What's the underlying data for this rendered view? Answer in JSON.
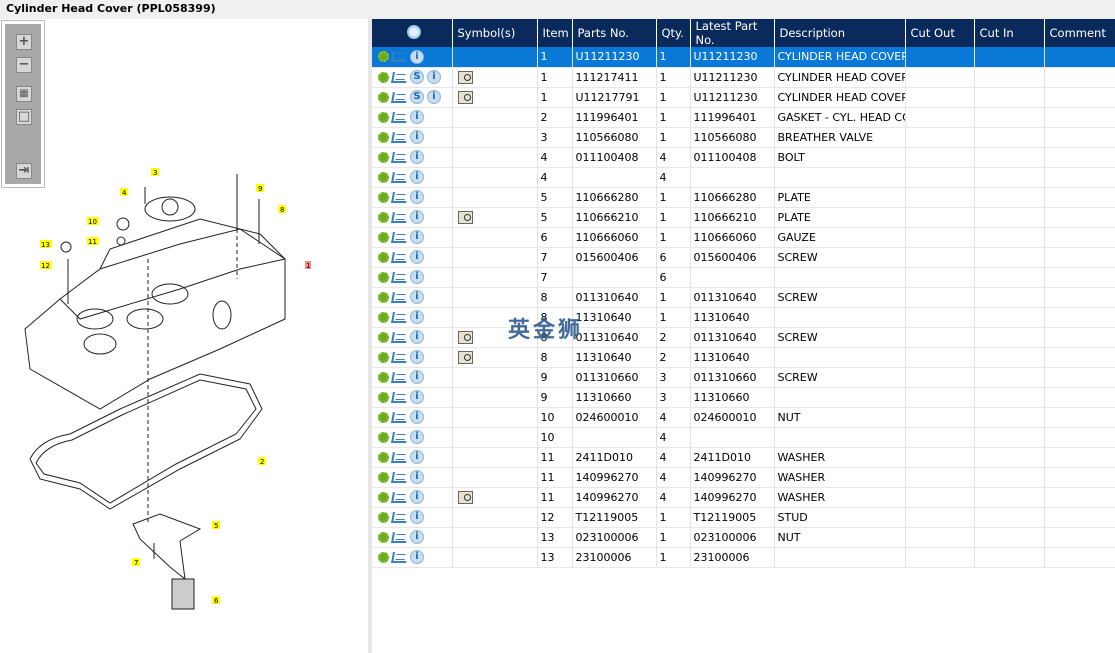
{
  "title": "Cylinder Head Cover (PPL058399)",
  "toolbar": {
    "zoom_in": "+",
    "zoom_out": "−",
    "fit": "▦",
    "actual": "□",
    "export": "⇥"
  },
  "diagram": {
    "callouts": [
      "1",
      "2",
      "3",
      "4",
      "5",
      "6",
      "7",
      "8",
      "9",
      "10",
      "11",
      "12",
      "13"
    ]
  },
  "watermark": "英金狮",
  "colors": {
    "header": "#0b2a5c",
    "selected": "#0a78d7",
    "callout": "#ffff00"
  },
  "table": {
    "headers": [
      "",
      "Symbol(s)",
      "Item",
      "Parts No.",
      "Qty.",
      "Latest Part No.",
      "Description",
      "Cut Out",
      "Cut In",
      "Comment"
    ],
    "rows": [
      {
        "s": false,
        "b": false,
        "item": "1",
        "part": "U11211230",
        "qty": "1",
        "latest": "U11211230",
        "desc": "CYLINDER HEAD COVER"
      },
      {
        "s": true,
        "b": true,
        "item": "1",
        "part": "111217411",
        "qty": "1",
        "latest": "U11211230",
        "desc": "CYLINDER HEAD COVER"
      },
      {
        "s": true,
        "b": true,
        "item": "1",
        "part": "U11217791",
        "qty": "1",
        "latest": "U11211230",
        "desc": "CYLINDER HEAD COVER"
      },
      {
        "s": false,
        "b": false,
        "item": "2",
        "part": "111996401",
        "qty": "1",
        "latest": "111996401",
        "desc": "GASKET - CYL. HEAD COV"
      },
      {
        "s": false,
        "b": false,
        "item": "3",
        "part": "110566080",
        "qty": "1",
        "latest": "110566080",
        "desc": "BREATHER VALVE"
      },
      {
        "s": false,
        "b": false,
        "item": "4",
        "part": "011100408",
        "qty": "4",
        "latest": "011100408",
        "desc": "BOLT"
      },
      {
        "s": false,
        "b": false,
        "item": "4",
        "part": "",
        "qty": "4",
        "latest": "",
        "desc": ""
      },
      {
        "s": false,
        "b": false,
        "item": "5",
        "part": "110666280",
        "qty": "1",
        "latest": "110666280",
        "desc": "PLATE"
      },
      {
        "s": false,
        "b": true,
        "item": "5",
        "part": "110666210",
        "qty": "1",
        "latest": "110666210",
        "desc": "PLATE"
      },
      {
        "s": false,
        "b": false,
        "item": "6",
        "part": "110666060",
        "qty": "1",
        "latest": "110666060",
        "desc": "GAUZE"
      },
      {
        "s": false,
        "b": false,
        "item": "7",
        "part": "015600406",
        "qty": "6",
        "latest": "015600406",
        "desc": "SCREW"
      },
      {
        "s": false,
        "b": false,
        "item": "7",
        "part": "",
        "qty": "6",
        "latest": "",
        "desc": ""
      },
      {
        "s": false,
        "b": false,
        "item": "8",
        "part": "011310640",
        "qty": "1",
        "latest": "011310640",
        "desc": "SCREW"
      },
      {
        "s": false,
        "b": false,
        "item": "8",
        "part": "11310640",
        "qty": "1",
        "latest": "11310640",
        "desc": ""
      },
      {
        "s": false,
        "b": true,
        "item": "8",
        "part": "011310640",
        "qty": "2",
        "latest": "011310640",
        "desc": "SCREW"
      },
      {
        "s": false,
        "b": true,
        "item": "8",
        "part": "11310640",
        "qty": "2",
        "latest": "11310640",
        "desc": ""
      },
      {
        "s": false,
        "b": false,
        "item": "9",
        "part": "011310660",
        "qty": "3",
        "latest": "011310660",
        "desc": "SCREW"
      },
      {
        "s": false,
        "b": false,
        "item": "9",
        "part": "11310660",
        "qty": "3",
        "latest": "11310660",
        "desc": ""
      },
      {
        "s": false,
        "b": false,
        "item": "10",
        "part": "024600010",
        "qty": "4",
        "latest": "024600010",
        "desc": "NUT"
      },
      {
        "s": false,
        "b": false,
        "item": "10",
        "part": "",
        "qty": "4",
        "latest": "",
        "desc": ""
      },
      {
        "s": false,
        "b": false,
        "item": "11",
        "part": "2411D010",
        "qty": "4",
        "latest": "2411D010",
        "desc": "WASHER"
      },
      {
        "s": false,
        "b": false,
        "item": "11",
        "part": "140996270",
        "qty": "4",
        "latest": "140996270",
        "desc": "WASHER"
      },
      {
        "s": false,
        "b": true,
        "item": "11",
        "part": "140996270",
        "qty": "4",
        "latest": "140996270",
        "desc": "WASHER"
      },
      {
        "s": false,
        "b": false,
        "item": "12",
        "part": "T12119005",
        "qty": "1",
        "latest": "T12119005",
        "desc": "STUD"
      },
      {
        "s": false,
        "b": false,
        "item": "13",
        "part": "023100006",
        "qty": "1",
        "latest": "023100006",
        "desc": "NUT"
      },
      {
        "s": false,
        "b": false,
        "item": "13",
        "part": "23100006",
        "qty": "1",
        "latest": "23100006",
        "desc": ""
      }
    ]
  }
}
